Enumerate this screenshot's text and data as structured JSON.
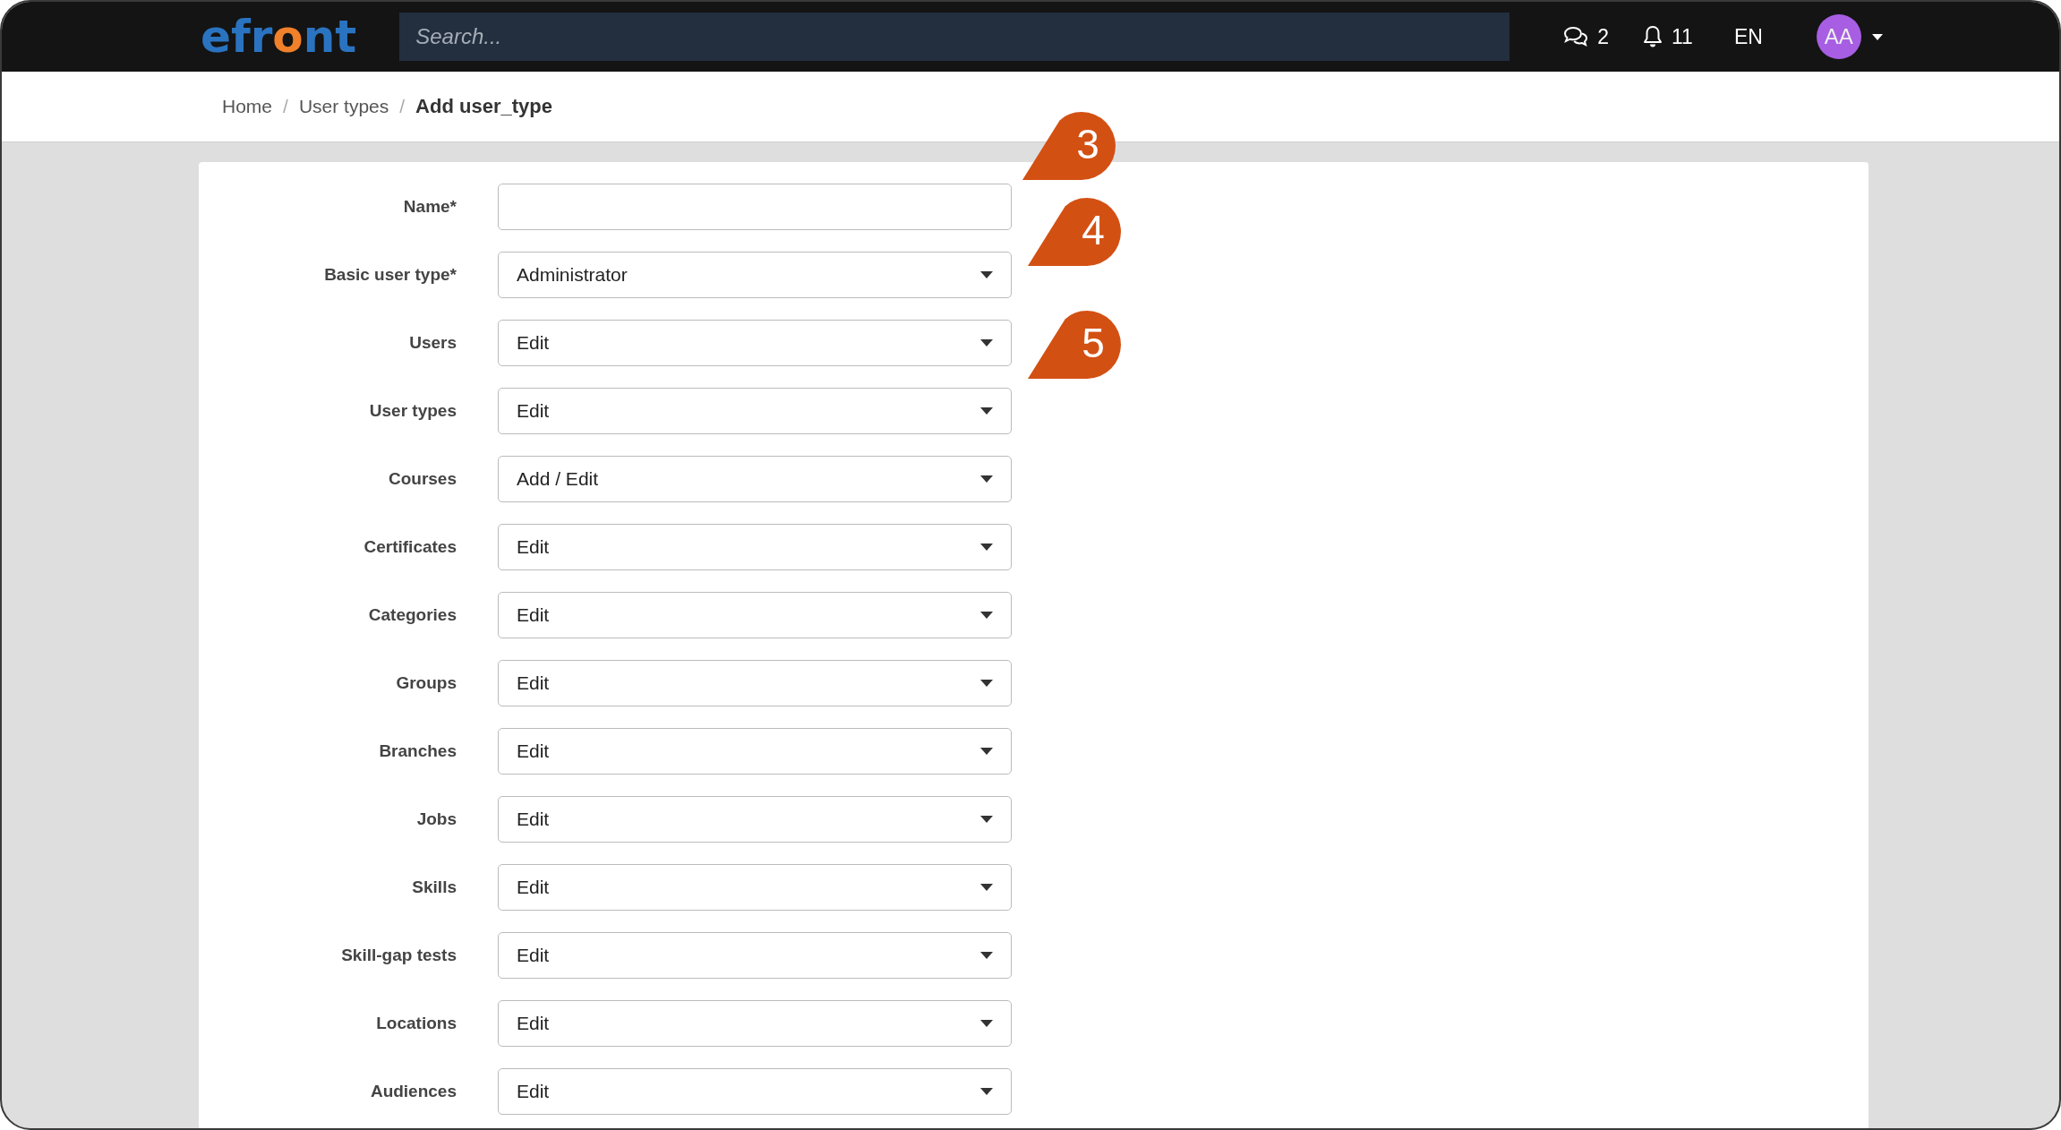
{
  "header": {
    "logo": "efront",
    "search": {
      "placeholder": "Search..."
    },
    "messages_count": "2",
    "notifications_count": "11",
    "language": "EN",
    "avatar": "AA"
  },
  "breadcrumb": [
    {
      "label": "Home",
      "current": false
    },
    {
      "separator": "/",
      "label": "User types",
      "current": false
    },
    {
      "separator": "/",
      "label": "Add user_type",
      "current": true
    }
  ],
  "form": {
    "fields": [
      {
        "label": "Name*",
        "kind": "text"
      },
      {
        "label": "Basic user type*",
        "kind": "select",
        "value": "Administrator"
      },
      {
        "label": "Users",
        "kind": "select",
        "value": "Edit"
      },
      {
        "label": "User types",
        "kind": "select",
        "value": "Edit"
      },
      {
        "label": "Courses",
        "kind": "select",
        "value": "Add / Edit"
      },
      {
        "label": "Certificates",
        "kind": "select",
        "value": "Edit"
      },
      {
        "label": "Categories",
        "kind": "select",
        "value": "Edit"
      },
      {
        "label": "Groups",
        "kind": "select",
        "value": "Edit"
      },
      {
        "label": "Branches",
        "kind": "select",
        "value": "Edit"
      },
      {
        "label": "Jobs",
        "kind": "select",
        "value": "Edit"
      },
      {
        "label": "Skills",
        "kind": "select",
        "value": "Edit"
      },
      {
        "label": "Skill-gap tests",
        "kind": "select",
        "value": "Edit"
      },
      {
        "label": "Locations",
        "kind": "select",
        "value": "Edit"
      },
      {
        "label": "Audiences",
        "kind": "select",
        "value": "Edit"
      }
    ]
  },
  "callouts": [
    {
      "number": "3"
    },
    {
      "number": "4"
    },
    {
      "number": "5"
    }
  ]
}
